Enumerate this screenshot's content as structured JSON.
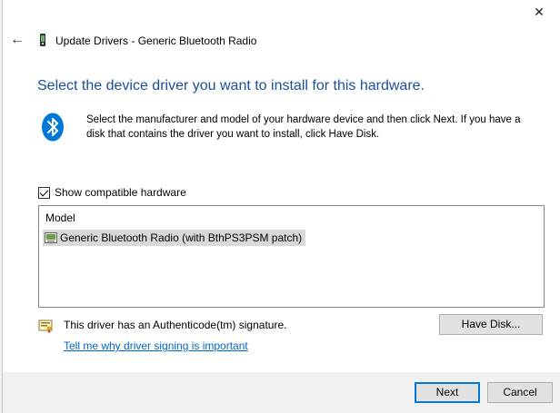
{
  "window": {
    "close_glyph": "✕",
    "back_glyph": "←",
    "title": "Update Drivers - Generic Bluetooth Radio"
  },
  "heading": "Select the device driver you want to install for this hardware.",
  "description": "Select the manufacturer and model of your hardware device and then click Next. If you have a disk that contains the driver you want to install, click Have Disk.",
  "compatible": {
    "label": "Show compatible hardware",
    "checked": true
  },
  "list": {
    "header": "Model",
    "items": [
      {
        "label": "Generic Bluetooth Radio (with BthPS3PSM patch)",
        "selected": true
      }
    ]
  },
  "signature": {
    "text": "This driver has an Authenticode(tm) signature.",
    "link": "Tell me why driver signing is important"
  },
  "buttons": {
    "have_disk": "Have Disk...",
    "next": "Next",
    "cancel": "Cancel"
  },
  "colors": {
    "heading": "#1b4fa0",
    "link": "#0066cc",
    "bluetooth": "#0078d7",
    "default_button_border": "#0078d7"
  },
  "icons": {
    "bluetooth": "bluetooth-icon",
    "device": "device-icon",
    "certificate": "certificate-icon"
  }
}
